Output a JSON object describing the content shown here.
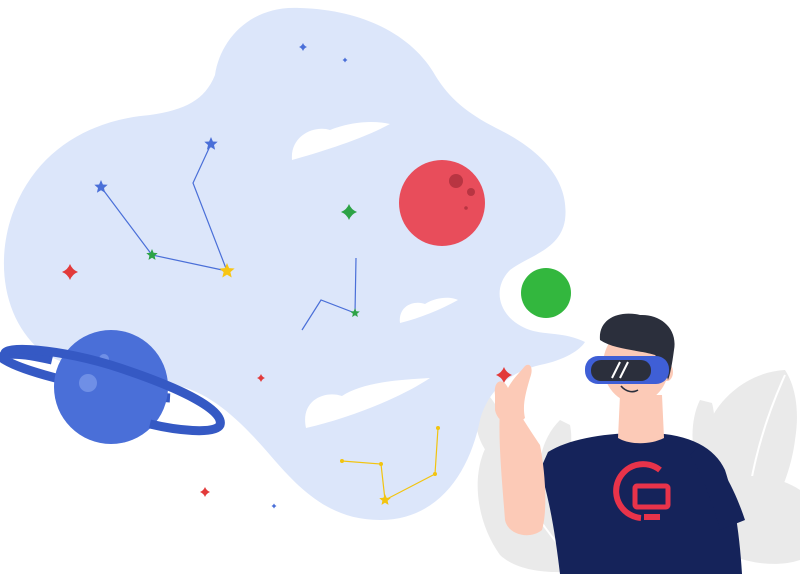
{
  "colors": {
    "background": "#ffffff",
    "cloud": "#dce6fa",
    "cloud_highlight": "#ffffff",
    "leaf": "#eaeaea",
    "leaf_vein": "#ffffff",
    "ring_planet": "#4a6fd8",
    "ring_planet_light": "#6f8fe6",
    "ring": "#3559c4",
    "red_planet": "#e84d5b",
    "red_planet_crater": "#b83542",
    "green_planet": "#33b73e",
    "constellation_blue": "#4a6fd8",
    "constellation_yellow": "#f2c40f",
    "star_green": "#2da346",
    "star_red": "#e23a3a",
    "star_yellow": "#f7c514",
    "hair": "#2b2f3c",
    "skin": "#fccab7",
    "visor_frame": "#3f5fd6",
    "visor_lens": "#2b2f3c",
    "shirt": "#15235a",
    "shirt_logo": "#e8334a"
  },
  "shirt_logo_icon": "brand-monitor-logo-icon",
  "scene_parts": [
    "space-thought-cloud",
    "ringed-planet",
    "red-planet",
    "green-planet",
    "constellation",
    "sparkle-star",
    "background-leaves",
    "vr-person"
  ]
}
